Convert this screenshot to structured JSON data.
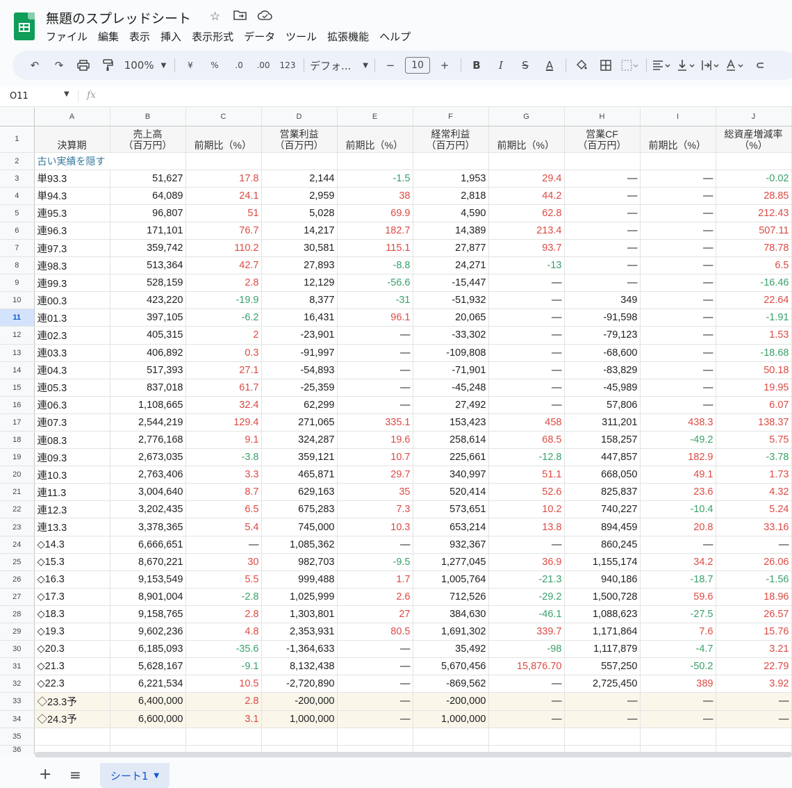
{
  "app": {
    "doc_title": "無題のスプレッドシート",
    "menu": [
      "ファイル",
      "編集",
      "表示",
      "挿入",
      "表示形式",
      "データ",
      "ツール",
      "拡張機能",
      "ヘルプ"
    ]
  },
  "toolbar": {
    "zoom": "100%",
    "currency": "¥",
    "percent": "%",
    "dec_decrease": ".0",
    "dec_increase": ".00",
    "format_123": "123",
    "font": "デフォ...",
    "minus": "−",
    "font_size": "10",
    "plus": "+",
    "bold": "B",
    "italic": "I",
    "strike": "S",
    "text_color": "A"
  },
  "formula_bar": {
    "cell_ref": "O11",
    "fx": "fx"
  },
  "columns": [
    "A",
    "B",
    "C",
    "D",
    "E",
    "F",
    "G",
    "H",
    "I",
    "J"
  ],
  "header_row": {
    "row_number": "1",
    "cells": [
      "決算期",
      "売上高\n（百万円）",
      "前期比（%）",
      "営業利益\n（百万円）",
      "前期比（%）",
      "経常利益\n（百万円）",
      "前期比（%）",
      "営業CF\n（百万円）",
      "前期比（%）",
      "総資産増減率\n（%）"
    ]
  },
  "row2": {
    "row_number": "2",
    "link_text": "古い実績を隠す"
  },
  "rows": [
    {
      "n": "3",
      "v": [
        "単93.3",
        "51,627",
        "17.8",
        "2,144",
        "-1.5",
        "1,953",
        "29.4",
        "—",
        "—",
        "-0.02"
      ],
      "c": [
        "",
        "",
        "r",
        "",
        "g",
        "",
        "r",
        "",
        "",
        "g"
      ]
    },
    {
      "n": "4",
      "v": [
        "単94.3",
        "64,089",
        "24.1",
        "2,959",
        "38",
        "2,818",
        "44.2",
        "—",
        "—",
        "28.85"
      ],
      "c": [
        "",
        "",
        "r",
        "",
        "r",
        "",
        "r",
        "",
        "",
        "r"
      ]
    },
    {
      "n": "5",
      "v": [
        "連95.3",
        "96,807",
        "51",
        "5,028",
        "69.9",
        "4,590",
        "62.8",
        "—",
        "—",
        "212.43"
      ],
      "c": [
        "",
        "",
        "r",
        "",
        "r",
        "",
        "r",
        "",
        "",
        "r"
      ]
    },
    {
      "n": "6",
      "v": [
        "連96.3",
        "171,101",
        "76.7",
        "14,217",
        "182.7",
        "14,389",
        "213.4",
        "—",
        "—",
        "507.11"
      ],
      "c": [
        "",
        "",
        "r",
        "",
        "r",
        "",
        "r",
        "",
        "",
        "r"
      ]
    },
    {
      "n": "7",
      "v": [
        "連97.3",
        "359,742",
        "110.2",
        "30,581",
        "115.1",
        "27,877",
        "93.7",
        "—",
        "—",
        "78.78"
      ],
      "c": [
        "",
        "",
        "r",
        "",
        "r",
        "",
        "r",
        "",
        "",
        "r"
      ]
    },
    {
      "n": "8",
      "v": [
        "連98.3",
        "513,364",
        "42.7",
        "27,893",
        "-8.8",
        "24,271",
        "-13",
        "—",
        "—",
        "6.5"
      ],
      "c": [
        "",
        "",
        "r",
        "",
        "g",
        "",
        "g",
        "",
        "",
        "r"
      ]
    },
    {
      "n": "9",
      "v": [
        "連99.3",
        "528,159",
        "2.8",
        "12,129",
        "-56.6",
        "-15,447",
        "—",
        "—",
        "—",
        "-16.46"
      ],
      "c": [
        "",
        "",
        "r",
        "",
        "g",
        "",
        "",
        "",
        "",
        "g"
      ]
    },
    {
      "n": "10",
      "v": [
        "連00.3",
        "423,220",
        "-19.9",
        "8,377",
        "-31",
        "-51,932",
        "—",
        "349",
        "—",
        "22.64"
      ],
      "c": [
        "",
        "",
        "g",
        "",
        "g",
        "",
        "",
        "",
        "",
        "r"
      ]
    },
    {
      "n": "11",
      "v": [
        "連01.3",
        "397,105",
        "-6.2",
        "16,431",
        "96.1",
        "20,065",
        "—",
        "-91,598",
        "—",
        "-1.91"
      ],
      "c": [
        "",
        "",
        "g",
        "",
        "r",
        "",
        "",
        "",
        "",
        "g"
      ]
    },
    {
      "n": "12",
      "v": [
        "連02.3",
        "405,315",
        "2",
        "-23,901",
        "—",
        "-33,302",
        "—",
        "-79,123",
        "—",
        "1.53"
      ],
      "c": [
        "",
        "",
        "r",
        "",
        "",
        "",
        "",
        "",
        "",
        "r"
      ]
    },
    {
      "n": "13",
      "v": [
        "連03.3",
        "406,892",
        "0.3",
        "-91,997",
        "—",
        "-109,808",
        "—",
        "-68,600",
        "—",
        "-18.68"
      ],
      "c": [
        "",
        "",
        "r",
        "",
        "",
        "",
        "",
        "",
        "",
        "g"
      ]
    },
    {
      "n": "14",
      "v": [
        "連04.3",
        "517,393",
        "27.1",
        "-54,893",
        "—",
        "-71,901",
        "—",
        "-83,829",
        "—",
        "50.18"
      ],
      "c": [
        "",
        "",
        "r",
        "",
        "",
        "",
        "",
        "",
        "",
        "r"
      ]
    },
    {
      "n": "15",
      "v": [
        "連05.3",
        "837,018",
        "61.7",
        "-25,359",
        "—",
        "-45,248",
        "—",
        "-45,989",
        "—",
        "19.95"
      ],
      "c": [
        "",
        "",
        "r",
        "",
        "",
        "",
        "",
        "",
        "",
        "r"
      ]
    },
    {
      "n": "16",
      "v": [
        "連06.3",
        "1,108,665",
        "32.4",
        "62,299",
        "—",
        "27,492",
        "—",
        "57,806",
        "—",
        "6.07"
      ],
      "c": [
        "",
        "",
        "r",
        "",
        "",
        "",
        "",
        "",
        "",
        "r"
      ]
    },
    {
      "n": "17",
      "v": [
        "連07.3",
        "2,544,219",
        "129.4",
        "271,065",
        "335.1",
        "153,423",
        "458",
        "311,201",
        "438.3",
        "138.37"
      ],
      "c": [
        "",
        "",
        "r",
        "",
        "r",
        "",
        "r",
        "",
        "r",
        "r"
      ]
    },
    {
      "n": "18",
      "v": [
        "連08.3",
        "2,776,168",
        "9.1",
        "324,287",
        "19.6",
        "258,614",
        "68.5",
        "158,257",
        "-49.2",
        "5.75"
      ],
      "c": [
        "",
        "",
        "r",
        "",
        "r",
        "",
        "r",
        "",
        "g",
        "r"
      ]
    },
    {
      "n": "19",
      "v": [
        "連09.3",
        "2,673,035",
        "-3.8",
        "359,121",
        "10.7",
        "225,661",
        "-12.8",
        "447,857",
        "182.9",
        "-3.78"
      ],
      "c": [
        "",
        "",
        "g",
        "",
        "r",
        "",
        "g",
        "",
        "r",
        "g"
      ]
    },
    {
      "n": "20",
      "v": [
        "連10.3",
        "2,763,406",
        "3.3",
        "465,871",
        "29.7",
        "340,997",
        "51.1",
        "668,050",
        "49.1",
        "1.73"
      ],
      "c": [
        "",
        "",
        "r",
        "",
        "r",
        "",
        "r",
        "",
        "r",
        "r"
      ]
    },
    {
      "n": "21",
      "v": [
        "連11.3",
        "3,004,640",
        "8.7",
        "629,163",
        "35",
        "520,414",
        "52.6",
        "825,837",
        "23.6",
        "4.32"
      ],
      "c": [
        "",
        "",
        "r",
        "",
        "r",
        "",
        "r",
        "",
        "r",
        "r"
      ]
    },
    {
      "n": "22",
      "v": [
        "連12.3",
        "3,202,435",
        "6.5",
        "675,283",
        "7.3",
        "573,651",
        "10.2",
        "740,227",
        "-10.4",
        "5.24"
      ],
      "c": [
        "",
        "",
        "r",
        "",
        "r",
        "",
        "r",
        "",
        "g",
        "r"
      ]
    },
    {
      "n": "23",
      "v": [
        "連13.3",
        "3,378,365",
        "5.4",
        "745,000",
        "10.3",
        "653,214",
        "13.8",
        "894,459",
        "20.8",
        "33.16"
      ],
      "c": [
        "",
        "",
        "r",
        "",
        "r",
        "",
        "r",
        "",
        "r",
        "r"
      ]
    },
    {
      "n": "24",
      "v": [
        "◇14.3",
        "6,666,651",
        "—",
        "1,085,362",
        "—",
        "932,367",
        "—",
        "860,245",
        "—",
        "—"
      ],
      "c": [
        "",
        "",
        "",
        "",
        "",
        "",
        "",
        "",
        "",
        ""
      ]
    },
    {
      "n": "25",
      "v": [
        "◇15.3",
        "8,670,221",
        "30",
        "982,703",
        "-9.5",
        "1,277,045",
        "36.9",
        "1,155,174",
        "34.2",
        "26.06"
      ],
      "c": [
        "",
        "",
        "r",
        "",
        "g",
        "",
        "r",
        "",
        "r",
        "r"
      ]
    },
    {
      "n": "26",
      "v": [
        "◇16.3",
        "9,153,549",
        "5.5",
        "999,488",
        "1.7",
        "1,005,764",
        "-21.3",
        "940,186",
        "-18.7",
        "-1.56"
      ],
      "c": [
        "",
        "",
        "r",
        "",
        "r",
        "",
        "g",
        "",
        "g",
        "g"
      ]
    },
    {
      "n": "27",
      "v": [
        "◇17.3",
        "8,901,004",
        "-2.8",
        "1,025,999",
        "2.6",
        "712,526",
        "-29.2",
        "1,500,728",
        "59.6",
        "18.96"
      ],
      "c": [
        "",
        "",
        "g",
        "",
        "r",
        "",
        "g",
        "",
        "r",
        "r"
      ]
    },
    {
      "n": "28",
      "v": [
        "◇18.3",
        "9,158,765",
        "2.8",
        "1,303,801",
        "27",
        "384,630",
        "-46.1",
        "1,088,623",
        "-27.5",
        "26.57"
      ],
      "c": [
        "",
        "",
        "r",
        "",
        "r",
        "",
        "g",
        "",
        "g",
        "r"
      ]
    },
    {
      "n": "29",
      "v": [
        "◇19.3",
        "9,602,236",
        "4.8",
        "2,353,931",
        "80.5",
        "1,691,302",
        "339.7",
        "1,171,864",
        "7.6",
        "15.76"
      ],
      "c": [
        "",
        "",
        "r",
        "",
        "r",
        "",
        "r",
        "",
        "r",
        "r"
      ]
    },
    {
      "n": "30",
      "v": [
        "◇20.3",
        "6,185,093",
        "-35.6",
        "-1,364,633",
        "—",
        "35,492",
        "-98",
        "1,117,879",
        "-4.7",
        "3.21"
      ],
      "c": [
        "",
        "",
        "g",
        "",
        "",
        "",
        "g",
        "",
        "g",
        "r"
      ]
    },
    {
      "n": "31",
      "v": [
        "◇21.3",
        "5,628,167",
        "-9.1",
        "8,132,438",
        "—",
        "5,670,456",
        "15,876.70",
        "557,250",
        "-50.2",
        "22.79"
      ],
      "c": [
        "",
        "",
        "g",
        "",
        "",
        "",
        "r",
        "",
        "g",
        "r"
      ]
    },
    {
      "n": "32",
      "v": [
        "◇22.3",
        "6,221,534",
        "10.5",
        "-2,720,890",
        "—",
        "-869,562",
        "—",
        "2,725,450",
        "389",
        "3.92"
      ],
      "c": [
        "",
        "",
        "r",
        "",
        "",
        "",
        "",
        "",
        "r",
        "r"
      ]
    },
    {
      "n": "33",
      "v": [
        "◇23.3予",
        "6,400,000",
        "2.8",
        "-200,000",
        "—",
        "-200,000",
        "—",
        "—",
        "—",
        "—"
      ],
      "c": [
        "",
        "",
        "r",
        "",
        "",
        "",
        "",
        "",
        "",
        ""
      ],
      "f": true
    },
    {
      "n": "34",
      "v": [
        "◇24.3予",
        "6,600,000",
        "3.1",
        "1,000,000",
        "—",
        "1,000,000",
        "—",
        "—",
        "—",
        "—"
      ],
      "c": [
        "",
        "",
        "r",
        "",
        "",
        "",
        "",
        "",
        "",
        ""
      ],
      "f": true
    }
  ],
  "empty_rows": [
    "35",
    "36"
  ],
  "active_row": "11",
  "colors": {
    "positive": "#dc4a43",
    "negative": "#38a169",
    "link": "#33779b",
    "forecast_bg": "#faf6ea"
  },
  "sheet_tabs": {
    "active": "シート1"
  }
}
